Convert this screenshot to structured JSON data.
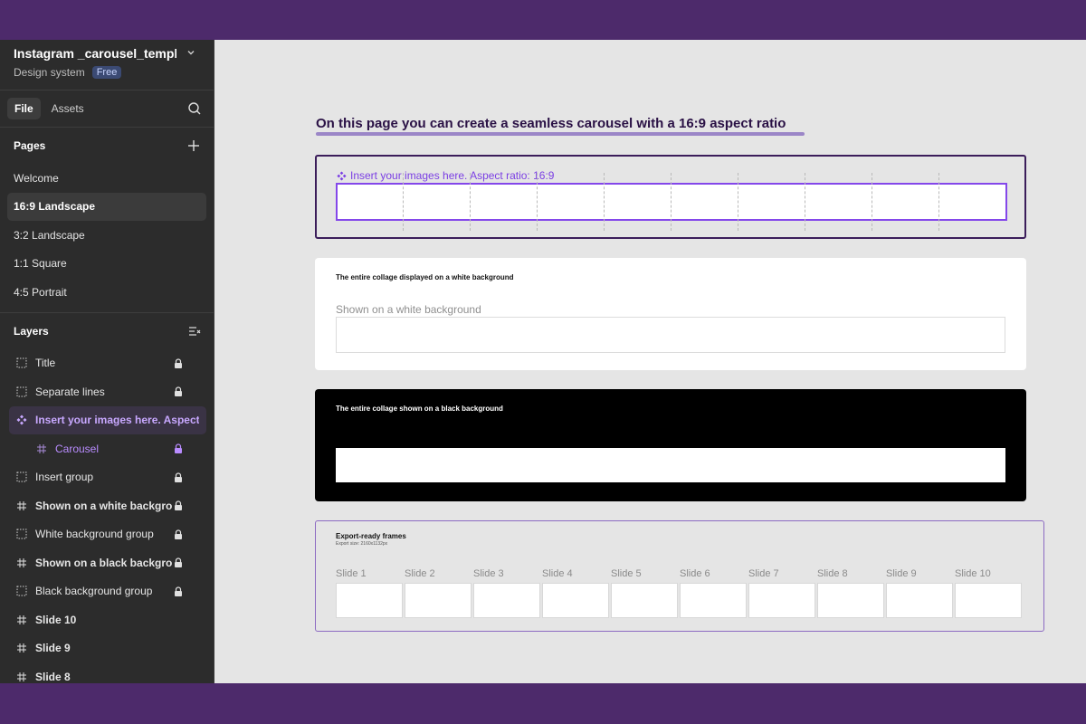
{
  "file": {
    "title": "Instagram _carousel_templ...",
    "subtitle": "Design system",
    "badge": "Free"
  },
  "tabs": {
    "file": "File",
    "assets": "Assets"
  },
  "pages": {
    "heading": "Pages",
    "items": [
      {
        "label": "Welcome"
      },
      {
        "label": "16:9 Landscape"
      },
      {
        "label": "3:2 Landscape"
      },
      {
        "label": "1:1 Square"
      },
      {
        "label": "4:5 Portrait"
      }
    ]
  },
  "layers": {
    "heading": "Layers",
    "items": [
      {
        "label": "Title"
      },
      {
        "label": "Separate lines"
      },
      {
        "label": "Insert your images here. Aspect r..."
      },
      {
        "label": "Carousel"
      },
      {
        "label": "Insert group"
      },
      {
        "label": "Shown on a white backgroun"
      },
      {
        "label": "White background group"
      },
      {
        "label": "Shown on a black backgroun"
      },
      {
        "label": "Black background group"
      },
      {
        "label": "Slide 10"
      },
      {
        "label": "Slide 9"
      },
      {
        "label": "Slide 8"
      }
    ]
  },
  "canvas": {
    "title": "On this page you can create a seamless carousel with a 16:9 aspect ratio",
    "insert_label": "Insert your images here. Aspect ratio: 16:9",
    "white_frame": {
      "title": "The entire collage displayed on a white background",
      "subtitle": "Shown on a white background"
    },
    "black_frame": {
      "title": "The entire collage shown on a black background"
    },
    "export": {
      "title": "Export-ready frames",
      "size": "Export size: 2160x1132px",
      "slides": [
        "Slide 1",
        "Slide 2",
        "Slide 3",
        "Slide 4",
        "Slide 5",
        "Slide 6",
        "Slide 7",
        "Slide 8",
        "Slide 9",
        "Slide 10"
      ]
    }
  },
  "colors": {
    "accent_purple": "#8447ea",
    "frame_border": "#3b1d5a",
    "outer_background": "#4d2a6b"
  }
}
